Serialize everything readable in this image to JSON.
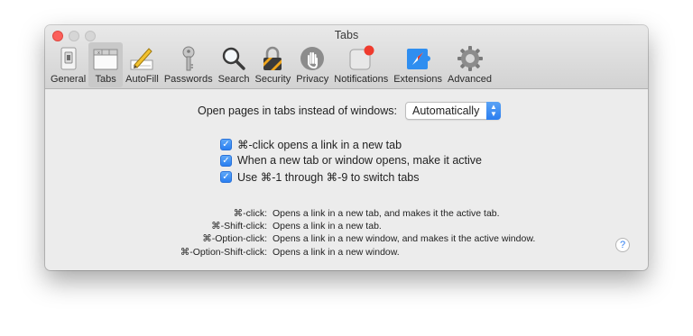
{
  "window": {
    "title": "Tabs"
  },
  "toolbar": {
    "items": [
      {
        "label": "General",
        "icon": "general-switch-icon",
        "active": false
      },
      {
        "label": "Tabs",
        "icon": "tabs-icon",
        "active": true
      },
      {
        "label": "AutoFill",
        "icon": "pencil-form-icon",
        "active": false
      },
      {
        "label": "Passwords",
        "icon": "key-icon",
        "active": false
      },
      {
        "label": "Search",
        "icon": "magnifier-icon",
        "active": false
      },
      {
        "label": "Security",
        "icon": "padlock-icon",
        "active": false
      },
      {
        "label": "Privacy",
        "icon": "hand-icon",
        "active": false
      },
      {
        "label": "Notifications",
        "icon": "notification-badge-icon",
        "active": false
      },
      {
        "label": "Extensions",
        "icon": "compass-puzzle-icon",
        "active": false
      },
      {
        "label": "Advanced",
        "icon": "gear-icon",
        "active": false
      }
    ]
  },
  "open_pages": {
    "label": "Open pages in tabs instead of windows:",
    "value": "Automatically"
  },
  "checkboxes": [
    {
      "label": "⌘-click opens a link in a new tab",
      "checked": true
    },
    {
      "label": "When a new tab or window opens, make it active",
      "checked": true
    },
    {
      "label": "Use ⌘-1 through ⌘-9 to switch tabs",
      "checked": true
    }
  ],
  "shortcuts": [
    {
      "key": "⌘-click:",
      "desc": "Opens a link in a new tab, and makes it the active tab."
    },
    {
      "key": "⌘-Shift-click:",
      "desc": "Opens a link in a new tab."
    },
    {
      "key": "⌘-Option-click:",
      "desc": "Opens a link in a new window, and makes it the active window."
    },
    {
      "key": "⌘-Option-Shift-click:",
      "desc": "Opens a link in a new window."
    }
  ],
  "help": {
    "label": "?"
  },
  "colors": {
    "accent": "#2b7ef0",
    "close": "#fc605b"
  }
}
